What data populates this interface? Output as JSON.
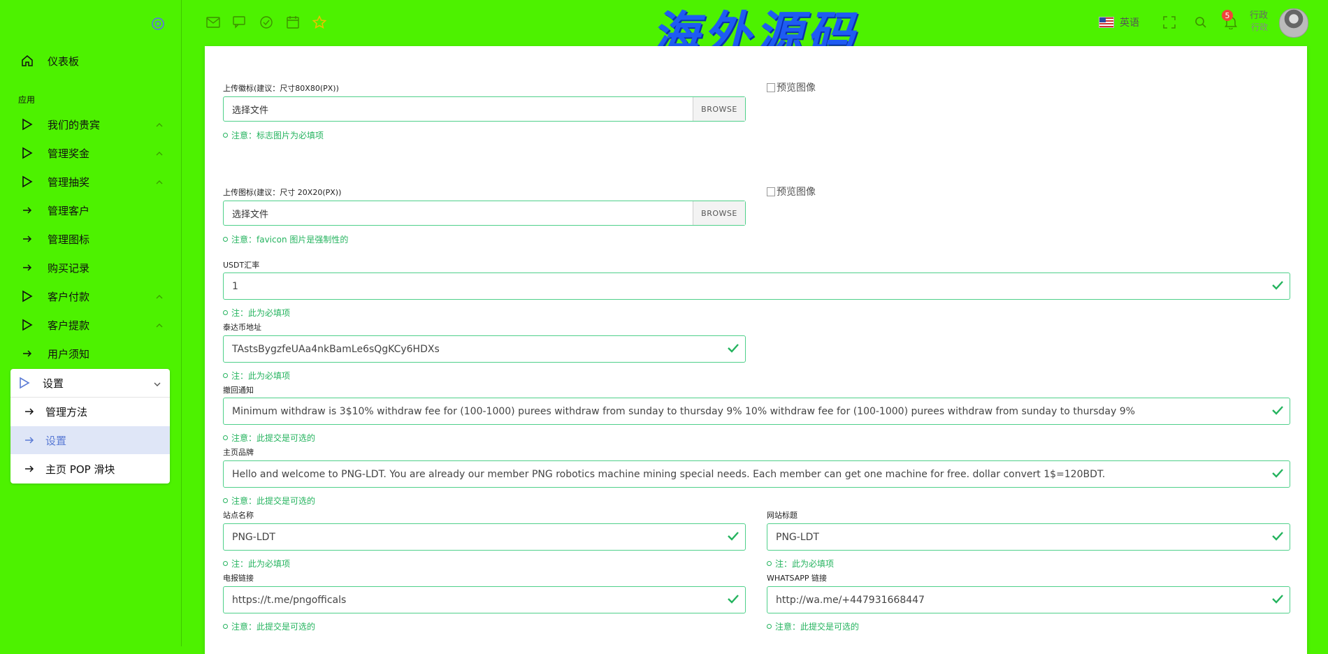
{
  "sidebar": {
    "dashboard": "仪表板",
    "section": "应用",
    "items": [
      {
        "label": "我们的贵宾",
        "icon": "play-icon",
        "expandable": true
      },
      {
        "label": "管理奖金",
        "icon": "play-icon",
        "expandable": true
      },
      {
        "label": "管理抽奖",
        "icon": "play-icon",
        "expandable": true
      },
      {
        "label": "管理客户",
        "icon": "arrow-right-icon",
        "expandable": false
      },
      {
        "label": "管理图标",
        "icon": "arrow-right-icon",
        "expandable": false
      },
      {
        "label": "购买记录",
        "icon": "arrow-right-icon",
        "expandable": false
      },
      {
        "label": "客户付款",
        "icon": "play-icon",
        "expandable": true
      },
      {
        "label": "客户提款",
        "icon": "play-icon",
        "expandable": true
      },
      {
        "label": "用户须知",
        "icon": "arrow-right-icon",
        "expandable": false
      }
    ],
    "settings_group": {
      "label": "设置",
      "children": [
        "管理方法",
        "设置",
        "主页 POP 滑块"
      ]
    }
  },
  "topbar": {
    "logo": "海外源码",
    "language": "英语",
    "notification_count": "5",
    "user_name": "行政",
    "user_role": "行政"
  },
  "form": {
    "logo_upload": {
      "label": "上传徽标(建议：尺寸80X80(PX))",
      "value": "选择文件",
      "button": "BROWSE",
      "note": "注意：标志图片为必填项",
      "preview": "预览图像"
    },
    "favicon_upload": {
      "label": "上传图标(建议：尺寸 20X20(PX))",
      "value": "选择文件",
      "button": "BROWSE",
      "note": "注意：favicon 图片是强制性的",
      "preview": "预览图像"
    },
    "usdt_rate": {
      "label": "USDT汇率",
      "value": "1",
      "note": "注：此为必填项"
    },
    "tron_address": {
      "label": "泰达币地址",
      "value": "TAstsBygzfeUAa4nkBamLe6sQgKCy6HDXs",
      "note": "注：此为必填项"
    },
    "withdraw_notice": {
      "label": "撤回通知",
      "value": "Minimum withdraw is 3$10% withdraw fee for (100-1000) purees withdraw from sunday to thursday 9% 10% withdraw fee for (100-1000) purees withdraw from sunday to thursday 9%",
      "note": "注意：此提交是可选的"
    },
    "home_brand": {
      "label": "主页品牌",
      "value": "Hello and welcome to PNG-LDT. You are already our member PNG robotics machine mining special needs. Each member can get one machine for free. dollar convert 1$=120BDT.",
      "note": "注意：此提交是可选的"
    },
    "site_name": {
      "label": "站点名称",
      "value": "PNG-LDT",
      "note": "注：此为必填项"
    },
    "site_title": {
      "label": "网站标题",
      "value": "PNG-LDT",
      "note": "注：此为必填项"
    },
    "telegram_link": {
      "label": "电报链接",
      "value": "https://t.me/pngofficals",
      "note": "注意：此提交是可选的"
    },
    "whatsapp_link": {
      "label": "WHATSAPP 链接",
      "value": "http://wa.me/+447931668447",
      "note": "注意：此提交是可选的"
    }
  },
  "colors": {
    "background": "#4df200",
    "accent": "#5b7bd5",
    "valid": "#24b35e",
    "logo": "#1e5cf2"
  }
}
